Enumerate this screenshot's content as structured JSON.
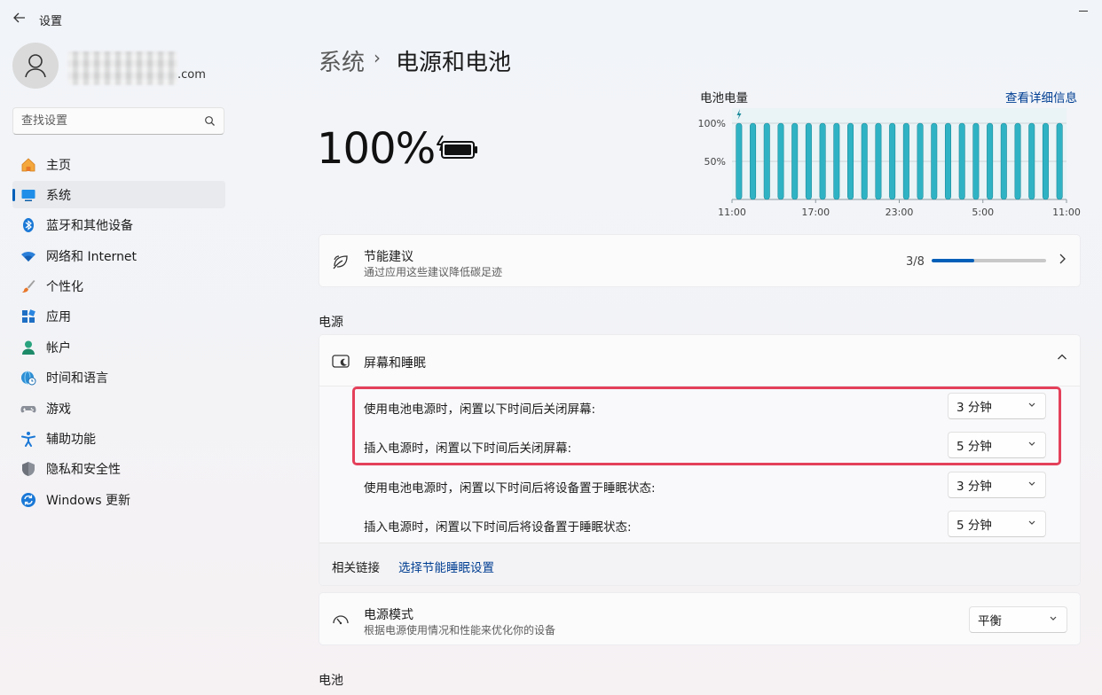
{
  "window": {
    "title": "设置",
    "back_icon": "back-arrow-icon"
  },
  "profile": {
    "email_suffix": ".com"
  },
  "search": {
    "placeholder": "查找设置"
  },
  "sidebar": {
    "items": [
      {
        "label": "主页",
        "icon": "home-icon"
      },
      {
        "label": "系统",
        "icon": "system-icon",
        "active": true
      },
      {
        "label": "蓝牙和其他设备",
        "icon": "bluetooth-icon"
      },
      {
        "label": "网络和 Internet",
        "icon": "wifi-icon"
      },
      {
        "label": "个性化",
        "icon": "brush-icon"
      },
      {
        "label": "应用",
        "icon": "apps-icon"
      },
      {
        "label": "帐户",
        "icon": "account-icon"
      },
      {
        "label": "时间和语言",
        "icon": "globe-clock-icon"
      },
      {
        "label": "游戏",
        "icon": "gamepad-icon"
      },
      {
        "label": "辅助功能",
        "icon": "accessibility-icon"
      },
      {
        "label": "隐私和安全性",
        "icon": "shield-icon"
      },
      {
        "label": "Windows 更新",
        "icon": "update-icon"
      }
    ]
  },
  "breadcrumb": {
    "parent": "系统",
    "separator": "›",
    "current": "电源和电池"
  },
  "battery": {
    "percent": "100%",
    "charging": true
  },
  "chart": {
    "title": "电池电量",
    "link": "查看详细信息"
  },
  "chart_data": {
    "type": "bar",
    "title": "电池电量",
    "y_ticks": [
      "100%",
      "50%"
    ],
    "x_ticks": [
      "11:00",
      "17:00",
      "23:00",
      "5:00",
      "11:00"
    ],
    "ylim": [
      0,
      100
    ],
    "bar_count": 24,
    "values": [
      100,
      100,
      100,
      100,
      100,
      100,
      100,
      100,
      100,
      100,
      100,
      100,
      100,
      100,
      100,
      100,
      100,
      100,
      100,
      100,
      100,
      100,
      100,
      100
    ],
    "bar_color": "#2fb3c4",
    "grid": true
  },
  "energy_tips": {
    "title": "节能建议",
    "subtitle": "通过应用这些建议降低碳足迹",
    "count": "3/8",
    "progress": 0.375
  },
  "sections": {
    "power": "电源",
    "battery": "电池"
  },
  "screen_sleep": {
    "title": "屏幕和睡眠",
    "rows": [
      {
        "label": "使用电池电源时，闲置以下时间后关闭屏幕:",
        "value": "3 分钟"
      },
      {
        "label": "插入电源时，闲置以下时间后关闭屏幕:",
        "value": "5 分钟"
      },
      {
        "label": "使用电池电源时，闲置以下时间后将设备置于睡眠状态:",
        "value": "3 分钟"
      },
      {
        "label": "插入电源时，闲置以下时间后将设备置于睡眠状态:",
        "value": "5 分钟"
      }
    ],
    "related_label": "相关链接",
    "related_link": "选择节能睡眠设置"
  },
  "power_mode": {
    "title": "电源模式",
    "subtitle": "根据电源使用情况和性能来优化你的设备",
    "value": "平衡"
  },
  "colors": {
    "accent": "#005fb8",
    "link": "#003e92",
    "highlight": "#e4405a",
    "chart": "#2fb3c4"
  }
}
